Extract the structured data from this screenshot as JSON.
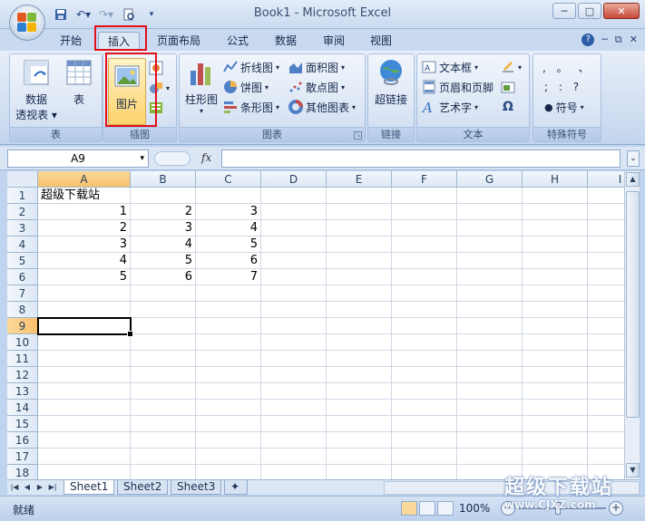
{
  "window": {
    "title": "Book1 - Microsoft Excel"
  },
  "tabs": [
    {
      "label": "开始"
    },
    {
      "label": "插入"
    },
    {
      "label": "页面布局"
    },
    {
      "label": "公式"
    },
    {
      "label": "数据"
    },
    {
      "label": "审阅"
    },
    {
      "label": "视图"
    }
  ],
  "active_tab": "插入",
  "ribbon": {
    "table_group": {
      "label": "表",
      "pivot_line1": "数据",
      "pivot_line2": "透视表",
      "table": "表"
    },
    "illustrations_group": {
      "label": "插图",
      "picture": "图片"
    },
    "charts_group": {
      "label": "图表",
      "column": "柱形图",
      "line": "折线图",
      "pie": "饼图",
      "bar": "条形图",
      "area": "面积图",
      "scatter": "散点图",
      "other": "其他图表"
    },
    "links_group": {
      "label": "链接",
      "hyperlink": "超链接"
    },
    "text_group": {
      "label": "文本",
      "textbox": "文本框",
      "header_footer": "页眉和页脚",
      "wordart": "艺术字",
      "omega": "Ω"
    },
    "symbols_group": {
      "label": "特殊符号",
      "symbol": "符号",
      "punct_row1": ",  。 、",
      "punct_row2": ";  :  ?"
    }
  },
  "formula_bar": {
    "name_box": "A9",
    "fx": "fx",
    "value": ""
  },
  "columns": [
    "A",
    "B",
    "C",
    "D",
    "E",
    "F",
    "G",
    "H",
    "I"
  ],
  "rows": [
    "1",
    "2",
    "3",
    "4",
    "5",
    "6",
    "7",
    "8",
    "9",
    "10",
    "11",
    "12",
    "13",
    "14",
    "15",
    "16",
    "17",
    "18"
  ],
  "cells": {
    "A1": "超级下载站",
    "A2": "1",
    "B2": "2",
    "C2": "3",
    "A3": "2",
    "B3": "3",
    "C3": "4",
    "A4": "3",
    "B4": "4",
    "C4": "5",
    "A5": "4",
    "B5": "5",
    "C5": "6",
    "A6": "5",
    "B6": "6",
    "C6": "7"
  },
  "selected_cell": "A9",
  "sheet_tabs": [
    "Sheet1",
    "Sheet2",
    "Sheet3"
  ],
  "active_sheet": "Sheet1",
  "status": {
    "text": "就绪",
    "zoom": "100%"
  },
  "watermark": {
    "text": "超级下载站",
    "url": "www.CJXZ.com"
  },
  "colors": {
    "selection_highlight": "#f8c06b",
    "callout_border": "#e0101a",
    "ribbon_bg": "#cfddf1"
  }
}
